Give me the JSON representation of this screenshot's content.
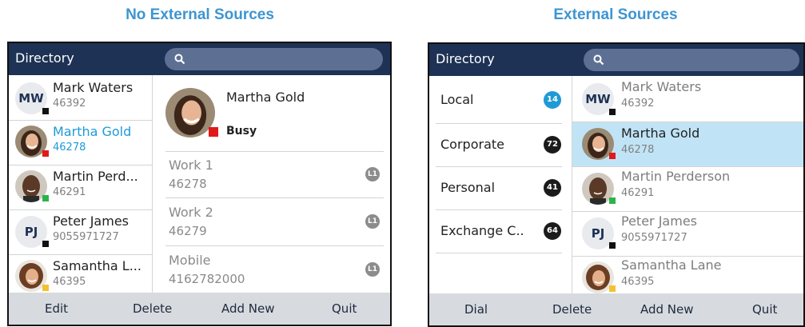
{
  "captions": {
    "left": "No External Sources",
    "right": "External Sources"
  },
  "left_phone": {
    "title": "Directory",
    "contacts": [
      {
        "name": "Mark Waters",
        "number": "46392",
        "initials": "MW",
        "status_color": "#111111",
        "avatar": "initials"
      },
      {
        "name": "Martha Gold",
        "number": "46278",
        "status_color": "#e01a1a",
        "avatar": "photo-woman-dark-hair"
      },
      {
        "name": "Martin Perd...",
        "number": "46291",
        "status_color": "#2db34a",
        "avatar": "photo-man-dark-skin"
      },
      {
        "name": "Peter James",
        "number": "9055971727",
        "initials": "PJ",
        "status_color": "#111111",
        "avatar": "initials"
      },
      {
        "name": "Samantha L...",
        "number": "46395",
        "status_color": "#f2c230",
        "avatar": "photo-woman-curly-hair"
      }
    ],
    "detail": {
      "name": "Martha Gold",
      "status": "Busy",
      "status_color": "#e01a1a",
      "fields": [
        {
          "label": "Work 1",
          "value": "46278",
          "line": "L1"
        },
        {
          "label": "Work 2",
          "value": "46279",
          "line": "L1"
        },
        {
          "label": "Mobile",
          "value": "4162782000",
          "line": "L1"
        }
      ]
    },
    "softkeys": [
      "Edit",
      "Delete",
      "Add New",
      "Quit"
    ]
  },
  "right_phone": {
    "title": "Directory",
    "sources": [
      {
        "label": "Local",
        "count": "14",
        "badge_color": "#1f9ad6",
        "active": true
      },
      {
        "label": "Corporate",
        "count": "72",
        "badge_color": "#1b1b1b",
        "active": false
      },
      {
        "label": "Personal",
        "count": "41",
        "badge_color": "#1b1b1b",
        "active": false
      },
      {
        "label": "Exchange C..",
        "count": "64",
        "badge_color": "#1b1b1b",
        "active": false
      }
    ],
    "contacts": [
      {
        "name": "Mark Waters",
        "number": "46392",
        "initials": "MW",
        "status_color": "#111111",
        "avatar": "initials"
      },
      {
        "name": "Martha Gold",
        "number": "46278",
        "status_color": "#e01a1a",
        "avatar": "photo-woman-dark-hair"
      },
      {
        "name": "Martin Perderson",
        "number": "46291",
        "status_color": "#2db34a",
        "avatar": "photo-man-dark-skin"
      },
      {
        "name": "Peter James",
        "number": "9055971727",
        "initials": "PJ",
        "status_color": "#111111",
        "avatar": "initials"
      },
      {
        "name": "Samantha Lane",
        "number": "46395",
        "status_color": "#f2c230",
        "avatar": "photo-woman-curly-hair"
      }
    ],
    "softkeys": [
      "Dial",
      "Delete",
      "Add New",
      "Quit"
    ]
  }
}
